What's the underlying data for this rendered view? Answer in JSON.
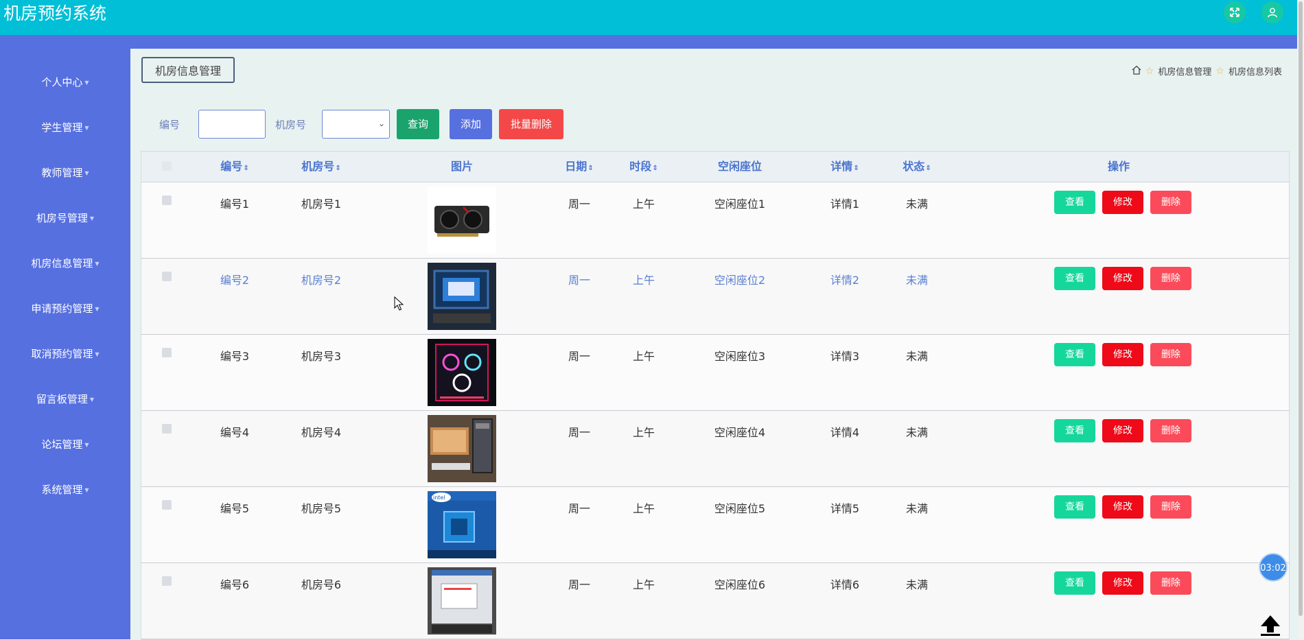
{
  "app": {
    "title": "机房预约系统"
  },
  "header_icons": [
    "fullscreen-icon",
    "user-icon"
  ],
  "sidebar": {
    "items": [
      {
        "label": "个人中心"
      },
      {
        "label": "学生管理"
      },
      {
        "label": "教师管理"
      },
      {
        "label": "机房号管理"
      },
      {
        "label": "机房信息管理"
      },
      {
        "label": "申请预约管理"
      },
      {
        "label": "取消预约管理"
      },
      {
        "label": "留言板管理"
      },
      {
        "label": "论坛管理"
      },
      {
        "label": "系统管理"
      }
    ]
  },
  "page": {
    "section_title": "机房信息管理",
    "breadcrumb": [
      "机房信息管理",
      "机房信息列表"
    ]
  },
  "search": {
    "bianhao_label": "编号",
    "bianhao_value": "",
    "jifanghao_label": "机房号",
    "jifanghao_value": "",
    "query_label": "查询",
    "add_label": "添加",
    "batch_delete_label": "批量删除"
  },
  "table": {
    "columns": [
      "编号",
      "机房号",
      "图片",
      "日期",
      "时段",
      "空闲座位",
      "详情",
      "状态",
      "操作"
    ],
    "sortable": [
      true,
      true,
      false,
      true,
      true,
      false,
      true,
      true,
      false
    ],
    "rows": [
      {
        "bianhao": "编号1",
        "jifanghao": "机房号1",
        "riqi": "周一",
        "shiduan": "上午",
        "zuowei": "空闲座位1",
        "xiangqing": "详情1",
        "zhuangtai": "未满",
        "image": "graphics-card"
      },
      {
        "bianhao": "编号2",
        "jifanghao": "机房号2",
        "riqi": "周一",
        "shiduan": "上午",
        "zuowei": "空闲座位2",
        "xiangqing": "详情2",
        "zhuangtai": "未满",
        "image": "monitor-setup"
      },
      {
        "bianhao": "编号3",
        "jifanghao": "机房号3",
        "riqi": "周一",
        "shiduan": "上午",
        "zuowei": "空闲座位3",
        "xiangqing": "详情3",
        "zhuangtai": "未满",
        "image": "rgb-pc-case"
      },
      {
        "bianhao": "编号4",
        "jifanghao": "机房号4",
        "riqi": "周一",
        "shiduan": "上午",
        "zuowei": "空闲座位4",
        "xiangqing": "详情4",
        "zhuangtai": "未满",
        "image": "desktop-pc"
      },
      {
        "bianhao": "编号5",
        "jifanghao": "机房号5",
        "riqi": "周一",
        "shiduan": "上午",
        "zuowei": "空闲座位5",
        "xiangqing": "详情5",
        "zhuangtai": "未满",
        "image": "intel-cpu-box"
      },
      {
        "bianhao": "编号6",
        "jifanghao": "机房号6",
        "riqi": "周一",
        "shiduan": "上午",
        "zuowei": "空闲座位6",
        "xiangqing": "详情6",
        "zhuangtai": "未满",
        "image": "screen-window"
      }
    ],
    "highlighted_row": 1,
    "actions": {
      "view": "查看",
      "edit": "修改",
      "delete": "删除"
    }
  },
  "widgets": {
    "timer": "03:02"
  },
  "colors": {
    "topbar": "#00bfd6",
    "sidebar": "#5670e0",
    "query_button": "#1aa36d",
    "add_button": "#5670e0",
    "batch_delete_button": "#f44848",
    "view_button": "#15d79b",
    "edit_button": "#ee0a18",
    "delete_button": "#fb4b5a",
    "header_text": "#4b74d0"
  }
}
